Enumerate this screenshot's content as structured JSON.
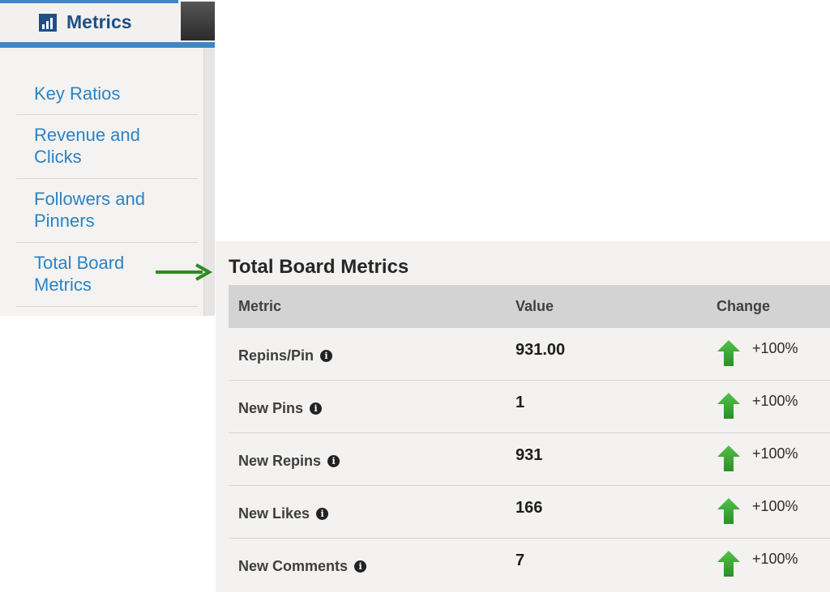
{
  "sidebar": {
    "title": "Metrics",
    "title_icon": "bar-chart-icon",
    "items": [
      {
        "label": "Key Ratios"
      },
      {
        "label": "Revenue and\nClicks"
      },
      {
        "label": "Followers and\nPinners"
      },
      {
        "label": "Total Board\nMetrics"
      }
    ]
  },
  "panel": {
    "title": "Total Board Metrics",
    "columns": [
      "Metric",
      "Value",
      "Change"
    ],
    "rows": [
      {
        "metric": "Repins/Pin",
        "value": "931.00",
        "change": "+100%"
      },
      {
        "metric": "New Pins",
        "value": "1",
        "change": "+100%"
      },
      {
        "metric": "New Repins",
        "value": "931",
        "change": "+100%"
      },
      {
        "metric": "New Likes",
        "value": "166",
        "change": "+100%"
      },
      {
        "metric": "New Comments",
        "value": "7",
        "change": "+100%"
      }
    ]
  },
  "colors": {
    "accent_blue": "#3f86c6",
    "link_blue": "#2a83c6",
    "title_blue": "#1f4f84",
    "arrow_green": "#2e8b1e",
    "up_green": "#36a330"
  },
  "icons": {
    "info": "info-icon",
    "up": "green-up-arrow-icon",
    "callout": "green-right-arrow-icon"
  }
}
